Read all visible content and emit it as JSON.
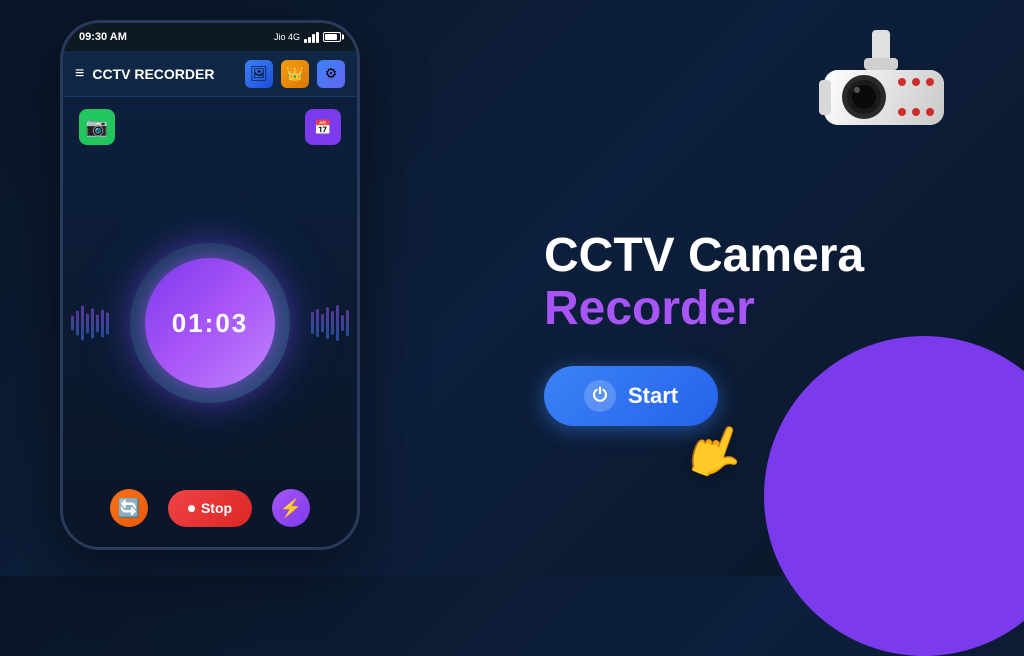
{
  "app": {
    "title": "CCTV RECORDER",
    "status_bar": {
      "time": "09:30 AM",
      "carrier": "Jio 4G"
    }
  },
  "phone": {
    "top_btn_green_label": "📷",
    "top_btn_purple_label": "📅",
    "timer_display": "01:03",
    "bottom_controls": {
      "refresh_btn": "🔄",
      "stop_label": "Stop",
      "lightning_btn": "⚡"
    }
  },
  "right_panel": {
    "headline_white": "CCTV Camera",
    "headline_purple": "Recorder",
    "start_button_label": "Start",
    "power_icon": "⏻"
  },
  "icons": {
    "menu_icon": "≡",
    "gallery_icon": "🖼",
    "crown_icon": "👑",
    "settings_icon": "⚙",
    "camera_icon": "📷",
    "record_icon": "⏺",
    "stop_icon": "⏺"
  }
}
